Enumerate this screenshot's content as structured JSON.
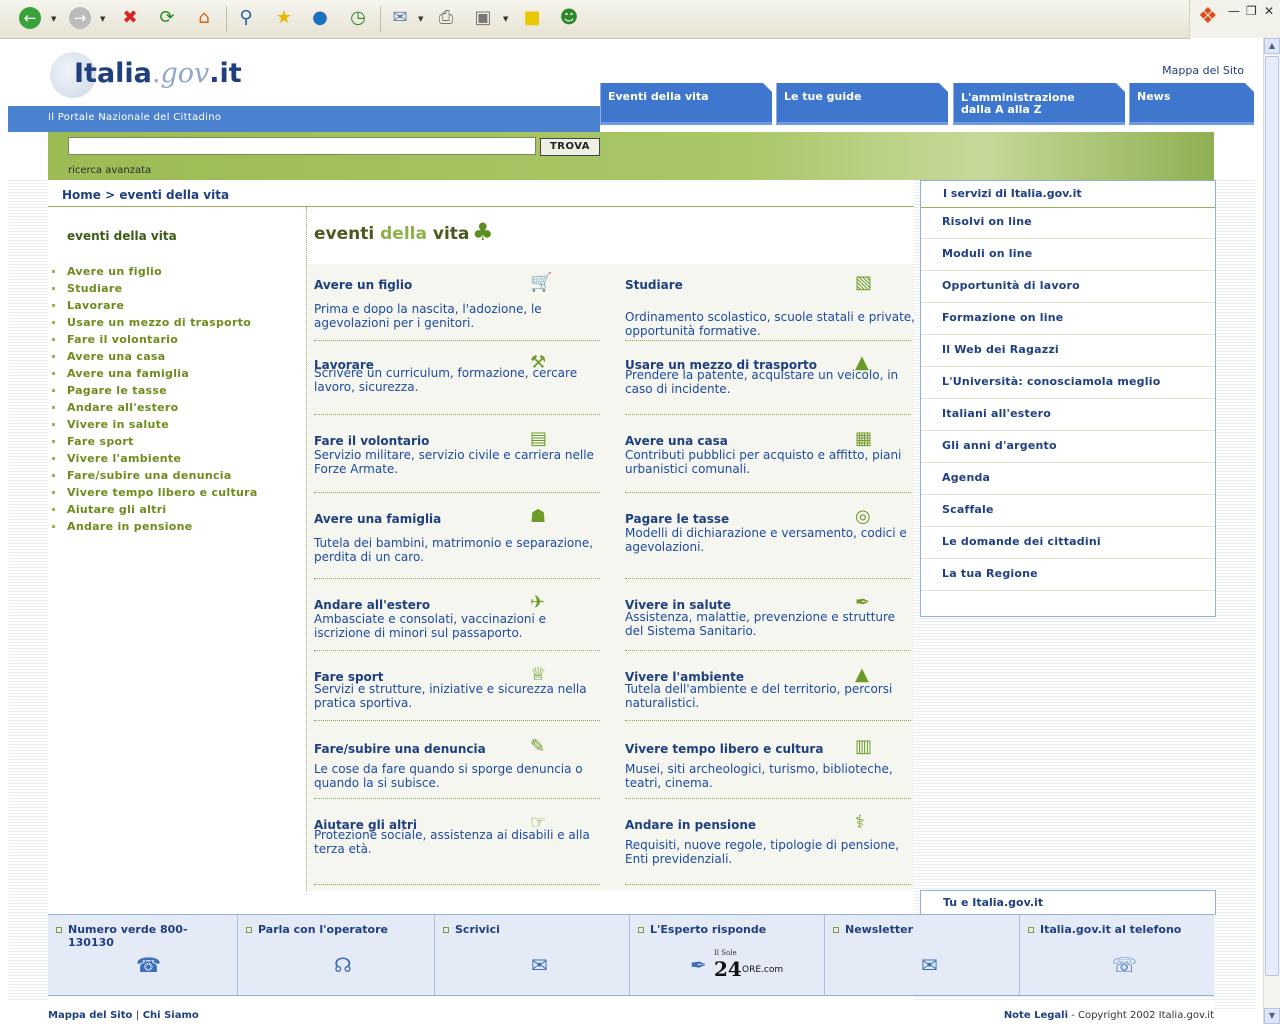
{
  "browser": {
    "toolbar_icons": [
      "back-icon",
      "forward-icon",
      "stop-icon",
      "refresh-icon",
      "home-icon",
      "search-icon",
      "favorites-icon",
      "media-icon",
      "history-icon",
      "mail-icon",
      "print-icon",
      "edit-icon",
      "notes-icon",
      "messenger-icon"
    ]
  },
  "header": {
    "logo_part1": "Italia",
    "logo_part2": ".gov",
    "logo_part3": ".it",
    "tagline": "Il Portale Nazionale del Cittadino",
    "sitemap_link": "Mappa del Sito",
    "nav": [
      {
        "line1": "Eventi della vita",
        "line2": ""
      },
      {
        "line1": "Le tue guide",
        "line2": ""
      },
      {
        "line1": "L'amministrazione",
        "line2": "dalla A alla Z"
      },
      {
        "line1": "News",
        "line2": ""
      }
    ]
  },
  "search": {
    "value": "",
    "button": "TROVA",
    "advanced": "ricerca avanzata"
  },
  "breadcrumb": {
    "home": "Home",
    "separator": ">",
    "current": "eventi della vita"
  },
  "sidebar": {
    "title": "eventi della vita",
    "items": [
      "Avere un figlio",
      "Studiare",
      "Lavorare",
      "Usare un mezzo di trasporto",
      "Fare il volontario",
      "Avere una casa",
      "Avere una famiglia",
      "Pagare le tasse",
      "Andare all'estero",
      "Vivere in salute",
      "Fare sport",
      "Vivere l'ambiente",
      "Fare/subire una denuncia",
      "Vivere tempo libero e cultura",
      "Aiutare gli altri",
      "Andare in pensione"
    ]
  },
  "main": {
    "title_part1": "eventi ",
    "title_part2": "della",
    "title_part3": " vita",
    "cells": [
      {
        "title": "Avere un figlio",
        "desc": "Prima e dopo la nascita, l'adozione, le agevolazioni per i genitori.",
        "icon": "stroller-icon"
      },
      {
        "title": "Studiare",
        "desc": "Ordinamento scolastico, scuole statali e private, opportunità formative.",
        "icon": "book-icon"
      },
      {
        "title": "Lavorare",
        "desc": "Scrivere un curriculum, formazione, cercare lavoro, sicurezza.",
        "icon": "hammer-icon"
      },
      {
        "title": "Usare un mezzo di trasporto",
        "desc": "Prendere la patente, acquistare un veicolo, in caso di incidente.",
        "icon": "car-icon"
      },
      {
        "title": "Fare il volontario",
        "desc": "Servizio militare, servizio civile e carriera nelle Forze Armate.",
        "icon": "briefcase-icon"
      },
      {
        "title": "Avere una casa",
        "desc": "Contributi pubblici per acquisto e affitto, piani urbanistici comunali.",
        "icon": "building-icon"
      },
      {
        "title": "Avere una famiglia",
        "desc": "Tutela dei bambini, matrimonio e separazione, perdita di un caro.",
        "icon": "family-icon"
      },
      {
        "title": "Pagare le tasse",
        "desc": "Modelli di dichiarazione e versamento, codici e agevolazioni.",
        "icon": "coins-icon"
      },
      {
        "title": "Andare all'estero",
        "desc": "Ambasciate e consolati, vaccinazioni e iscrizione di minori sul passaporto.",
        "icon": "airplane-icon"
      },
      {
        "title": "Vivere in salute",
        "desc": "Assistenza, malattie, prevenzione e strutture del Sistema Sanitario.",
        "icon": "syringe-icon"
      },
      {
        "title": "Fare sport",
        "desc": "Servizi e strutture, iniziative e sicurezza nella pratica sportiva.",
        "icon": "trophy-icon"
      },
      {
        "title": "Vivere l'ambiente",
        "desc": "Tutela dell'ambiente e del territorio, percorsi naturalistici.",
        "icon": "mountain-icon"
      },
      {
        "title": "Fare/subire una denuncia",
        "desc": "Le cose da fare quando si sporge denuncia o quando la si subisce.",
        "icon": "document-pen-icon"
      },
      {
        "title": "Vivere tempo libero e cultura",
        "desc": "Musei, siti archeologici, turismo, biblioteche, teatri, cinema.",
        "icon": "books-icon"
      },
      {
        "title": "Aiutare gli altri",
        "desc": "Protezione sociale, assistenza ai disabili e alla terza età.",
        "icon": "helping-hand-icon"
      },
      {
        "title": "Andare in pensione",
        "desc": "Requisiti, nuove regole, tipologie di pensione, Enti previdenziali.",
        "icon": "cane-icon"
      }
    ]
  },
  "services": {
    "title": "I servizi di Italia.gov.it",
    "items": [
      "Risolvi on line",
      "Moduli on line",
      "Opportunità di lavoro",
      "Formazione on line",
      "Il Web dei Ragazzi",
      "L'Università: conosciamola meglio",
      "Italiani all'estero",
      "Gli anni d'argento",
      "Agenda",
      "Scaffale",
      "Le domande dei cittadini",
      "La tua Regione"
    ]
  },
  "tu_box": {
    "title": "Tu e Italia.gov.it"
  },
  "footer": {
    "items": [
      {
        "label": "Numero verde 800-130130",
        "icon": "phone-icon"
      },
      {
        "label": "Parla con l'operatore",
        "icon": "headset-icon"
      },
      {
        "label": "Scrivici",
        "icon": "envelope-icon"
      },
      {
        "label": "L'Esperto risponde",
        "icon": "pen-nib-icon",
        "brand_small": "Il Sole",
        "brand_big": "24",
        "brand_rest": "ORE.com"
      },
      {
        "label": "Newsletter",
        "icon": "newsletter-icon"
      },
      {
        "label": "Italia.gov.it al telefono",
        "icon": "mobile-phones-icon"
      }
    ]
  },
  "bottom": {
    "sitemap": "Mappa del Sito",
    "sep": "|",
    "about": "Chi Siamo",
    "legal": "Note Legali",
    "copyright": " - Copyright 2002 Italia.gov.it"
  }
}
